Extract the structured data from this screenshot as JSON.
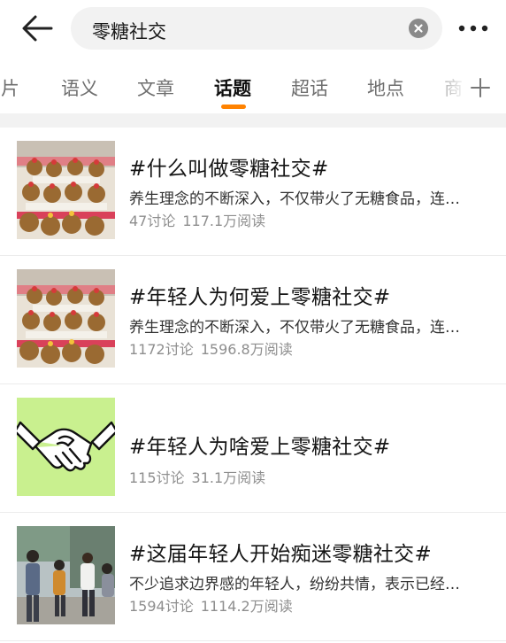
{
  "search": {
    "query": "零糖社交"
  },
  "icons": {
    "back": "arrow-left-icon",
    "clear": "clear-circle-icon",
    "more": "more-horizontal-icon",
    "add_tab": "plus-icon"
  },
  "tabs": [
    {
      "label": "图片",
      "active": false
    },
    {
      "label": "语义",
      "active": false
    },
    {
      "label": "文章",
      "active": false
    },
    {
      "label": "话题",
      "active": true
    },
    {
      "label": "超话",
      "active": false
    },
    {
      "label": "地点",
      "active": false
    },
    {
      "label": "商",
      "active": false
    }
  ],
  "colors": {
    "accent": "#ff8200",
    "thumb_green": "#c9f08f"
  },
  "results": [
    {
      "title": "#什么叫做零糖社交#",
      "desc": "养生理念的不断深入，不仅带火了无糖食品，连…",
      "discussions": "47讨论",
      "reads": "117.1万阅读",
      "thumb": "plush-toys-photo"
    },
    {
      "title": "#年轻人为何爱上零糖社交#",
      "desc": "养生理念的不断深入，不仅带火了无糖食品，连…",
      "discussions": "1172讨论",
      "reads": "1596.8万阅读",
      "thumb": "plush-toys-photo"
    },
    {
      "title": "#年轻人为啥爱上零糖社交#",
      "desc": "",
      "discussions": "115讨论",
      "reads": "31.1万阅读",
      "thumb": "handshake-icon"
    },
    {
      "title": "#这届年轻人开始痴迷零糖社交#",
      "desc": "不少追求边界感的年轻人，纷纷共情，表示已经…",
      "discussions": "1594讨论",
      "reads": "1114.2万阅读",
      "thumb": "people-dancing-photo"
    }
  ]
}
